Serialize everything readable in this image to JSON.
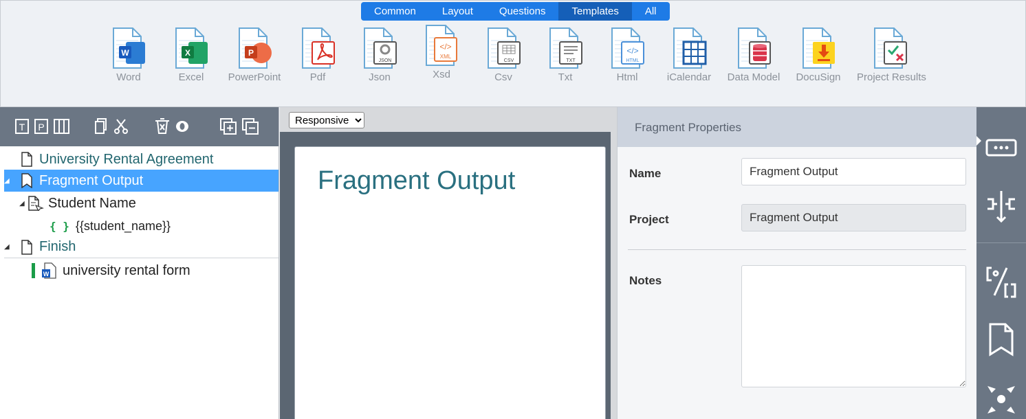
{
  "ribbon": {
    "tabs": [
      {
        "label": "Common",
        "active": false
      },
      {
        "label": "Layout",
        "active": false
      },
      {
        "label": "Questions",
        "active": false
      },
      {
        "label": "Templates",
        "active": true
      },
      {
        "label": "All",
        "active": false
      }
    ],
    "tools": [
      {
        "label": "Word",
        "icon": "word-file-icon"
      },
      {
        "label": "Excel",
        "icon": "excel-file-icon"
      },
      {
        "label": "PowerPoint",
        "icon": "powerpoint-file-icon"
      },
      {
        "label": "Pdf",
        "icon": "pdf-file-icon"
      },
      {
        "label": "Json",
        "icon": "json-file-icon",
        "badge": "JSON"
      },
      {
        "label": "Xsd",
        "icon": "xsd-file-icon",
        "badge": "XML"
      },
      {
        "label": "Csv",
        "icon": "csv-file-icon",
        "badge": "CSV"
      },
      {
        "label": "Txt",
        "icon": "txt-file-icon",
        "badge": "TXT"
      },
      {
        "label": "Html",
        "icon": "html-file-icon",
        "badge": "HTML"
      },
      {
        "label": "iCalendar",
        "icon": "calendar-file-icon"
      },
      {
        "label": "Data Model",
        "icon": "database-file-icon"
      },
      {
        "label": "DocuSign",
        "icon": "docusign-file-icon"
      },
      {
        "label": "Project Results",
        "icon": "project-results-file-icon"
      }
    ]
  },
  "tree": {
    "nodes": [
      {
        "label": "University Rental Agreement",
        "icon": "page-icon"
      },
      {
        "label": "Fragment Output",
        "icon": "fragment-icon",
        "selected": true
      },
      {
        "label": "Student Name",
        "icon": "question-icon"
      },
      {
        "label": "{{student_name}}",
        "icon": "variable-braces-icon",
        "glyph": "{ }"
      },
      {
        "label": "Finish",
        "icon": "page-icon"
      },
      {
        "label": "university rental form",
        "icon": "word-file-icon"
      }
    ]
  },
  "center": {
    "view_mode": "Responsive",
    "view_options": [
      "Responsive"
    ],
    "preview_title": "Fragment Output"
  },
  "properties": {
    "header": "Fragment Properties",
    "name_label": "Name",
    "name_value": "Fragment Output",
    "project_label": "Project",
    "project_value": "Fragment Output",
    "notes_label": "Notes",
    "notes_value": ""
  },
  "colors": {
    "tab_bg": "#1e7be6",
    "tab_active": "#155fb8",
    "selection": "#47a4ff",
    "toolbar": "#6b7684",
    "preview_title": "#2a7080"
  }
}
